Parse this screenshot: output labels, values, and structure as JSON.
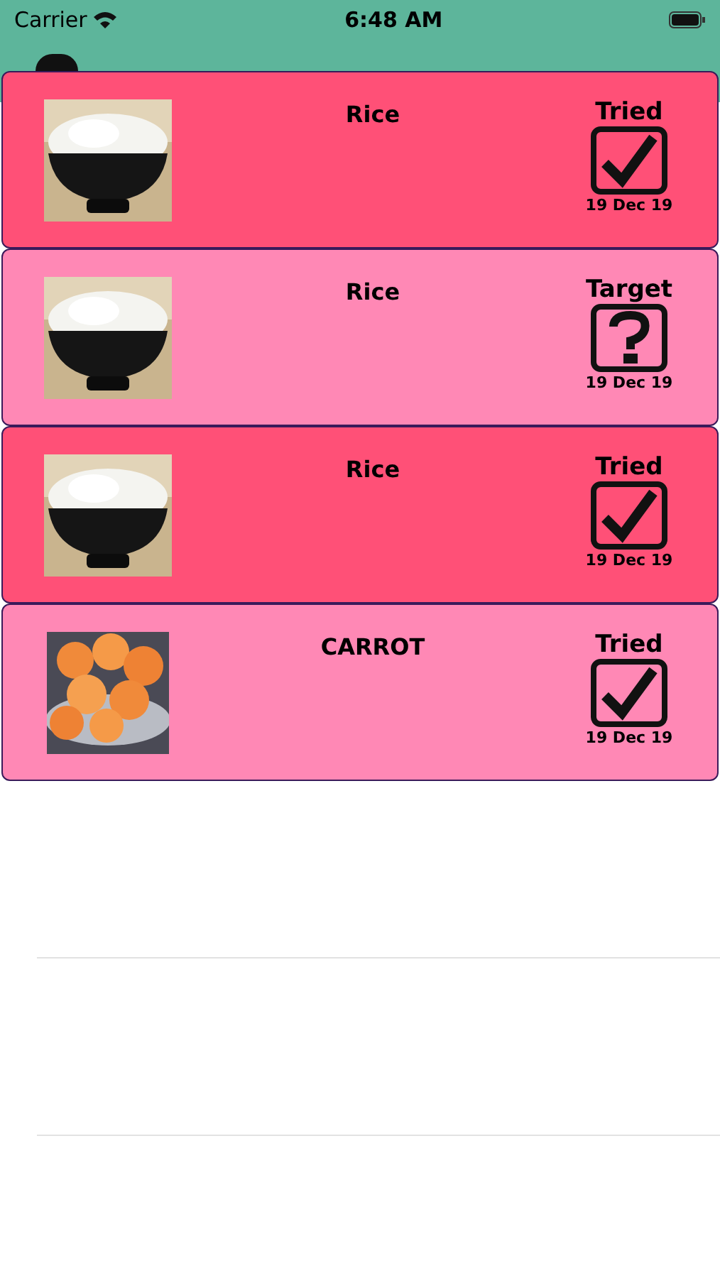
{
  "status_bar": {
    "carrier": "Carrier",
    "time": "6:48 AM"
  },
  "foods": [
    {
      "name": "Rice",
      "status": {
        "kind": "tried",
        "label": "Tried",
        "date": "19 Dec 19"
      }
    },
    {
      "name": "Rice",
      "status": {
        "kind": "target",
        "label": "Target",
        "date": "19 Dec 19"
      }
    },
    {
      "name": "Rice",
      "status": {
        "kind": "tried",
        "label": "Tried",
        "date": "19 Dec 19"
      }
    },
    {
      "name": "CARROT",
      "status": {
        "kind": "tried",
        "label": "Tried",
        "date": "19 Dec 19"
      }
    }
  ]
}
